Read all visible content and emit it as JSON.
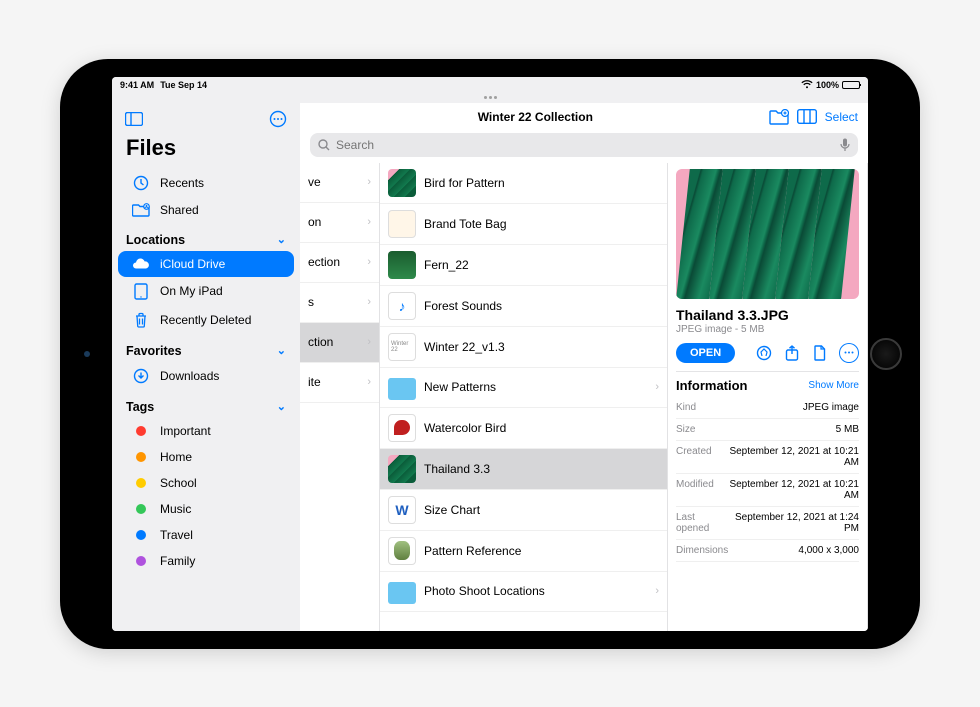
{
  "status": {
    "time": "9:41 AM",
    "date": "Tue Sep 14",
    "battery": "100%"
  },
  "sidebar": {
    "title": "Files",
    "browse": [
      {
        "icon": "clock",
        "label": "Recents"
      },
      {
        "icon": "folder-shared",
        "label": "Shared"
      }
    ],
    "sections": {
      "locations": "Locations",
      "favorites": "Favorites",
      "tags": "Tags"
    },
    "locations": [
      {
        "icon": "icloud",
        "label": "iCloud Drive",
        "selected": true
      },
      {
        "icon": "ipad",
        "label": "On My iPad"
      },
      {
        "icon": "trash",
        "label": "Recently Deleted"
      }
    ],
    "favorites": [
      {
        "icon": "download",
        "label": "Downloads"
      }
    ],
    "tags": [
      {
        "color": "#ff3b30",
        "label": "Important"
      },
      {
        "color": "#ff9500",
        "label": "Home"
      },
      {
        "color": "#ffcc00",
        "label": "School"
      },
      {
        "color": "#34c759",
        "label": "Music"
      },
      {
        "color": "#007aff",
        "label": "Travel"
      },
      {
        "color": "#af52de",
        "label": "Family"
      }
    ]
  },
  "toolbar": {
    "title": "Winter 22 Collection",
    "select": "Select"
  },
  "search": {
    "placeholder": "Search"
  },
  "col1": [
    {
      "label": "ve",
      "chevron": true
    },
    {
      "label": "on",
      "chevron": true
    },
    {
      "label": "ection",
      "chevron": true
    },
    {
      "label": "s",
      "chevron": true
    },
    {
      "label": "ction",
      "chevron": true,
      "selected": true
    },
    {
      "label": "ite",
      "chevron": true
    }
  ],
  "col2": [
    {
      "thumb": "leaves",
      "label": "Bird for Pattern"
    },
    {
      "thumb": "bag",
      "label": "Brand Tote Bag"
    },
    {
      "thumb": "fern",
      "label": "Fern_22"
    },
    {
      "thumb": "audio",
      "label": "Forest Sounds"
    },
    {
      "thumb": "doc",
      "label": "Winter 22_v1.3"
    },
    {
      "thumb": "folder",
      "label": "New Patterns",
      "chevron": true
    },
    {
      "thumb": "bird",
      "label": "Watercolor Bird"
    },
    {
      "thumb": "leaves",
      "label": "Thailand 3.3",
      "selected": true
    },
    {
      "thumb": "wblue",
      "label": "Size Chart"
    },
    {
      "thumb": "pattern",
      "label": "Pattern Reference"
    },
    {
      "thumb": "folder",
      "label": "Photo Shoot Locations",
      "chevron": true
    }
  ],
  "detail": {
    "filename": "Thailand 3.3.JPG",
    "subtitle": "JPEG image - 5 MB",
    "open": "OPEN",
    "info_header": "Information",
    "show_more": "Show More",
    "rows": [
      {
        "k": "Kind",
        "v": "JPEG image"
      },
      {
        "k": "Size",
        "v": "5 MB"
      },
      {
        "k": "Created",
        "v": "September 12, 2021 at 10:21 AM"
      },
      {
        "k": "Modified",
        "v": "September 12, 2021 at 10:21 AM"
      },
      {
        "k": "Last opened",
        "v": "September 12, 2021 at 1:24 PM"
      },
      {
        "k": "Dimensions",
        "v": "4,000 x 3,000"
      }
    ]
  }
}
